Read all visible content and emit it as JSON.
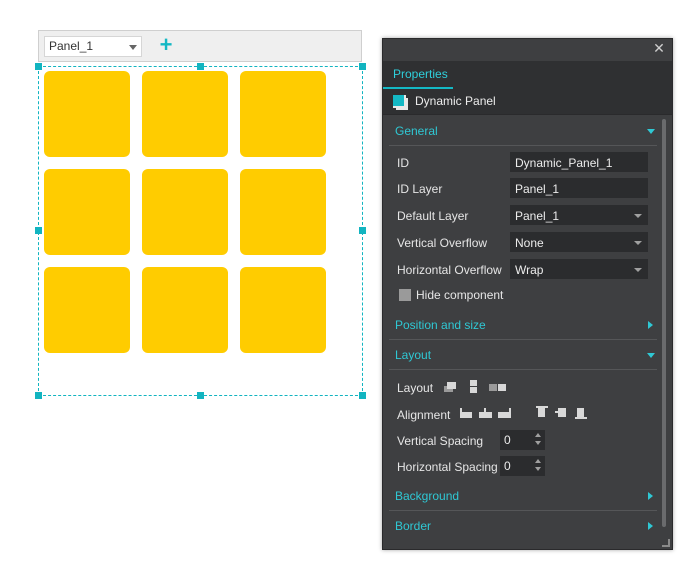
{
  "panel_toolbar": {
    "selected_panel": "Panel_1",
    "add_icon": "plus-icon"
  },
  "tiles": {
    "color": "#ffcc00",
    "rows": 3,
    "cols": 3
  },
  "selection_color": "#12b4c0",
  "properties": {
    "close_icon": "close-icon",
    "tab_label": "Properties",
    "component_icon": "dynamic-panel-icon",
    "component_name": "Dynamic Panel",
    "sections": {
      "general": "General",
      "position": "Position and size",
      "layout": "Layout",
      "background": "Background",
      "border": "Border"
    },
    "general": {
      "id_label": "ID",
      "id_value": "Dynamic_Panel_1",
      "id_layer_label": "ID Layer",
      "id_layer_value": "Panel_1",
      "default_layer_label": "Default Layer",
      "default_layer_value": "Panel_1",
      "vertical_overflow_label": "Vertical Overflow",
      "vertical_overflow_value": "None",
      "horizontal_overflow_label": "Horizontal Overflow",
      "horizontal_overflow_value": "Wrap",
      "hide_label": "Hide component",
      "hide_checked": false
    },
    "layout": {
      "layout_label": "Layout",
      "alignment_label": "Alignment",
      "vertical_spacing_label": "Vertical Spacing",
      "vertical_spacing_value": "0",
      "horizontal_spacing_label": "Horizontal Spacing",
      "horizontal_spacing_value": "0"
    }
  },
  "colors": {
    "accent": "#14b8c4",
    "panel_bg": "#3e3f41",
    "field_bg": "#2b2c2e"
  }
}
